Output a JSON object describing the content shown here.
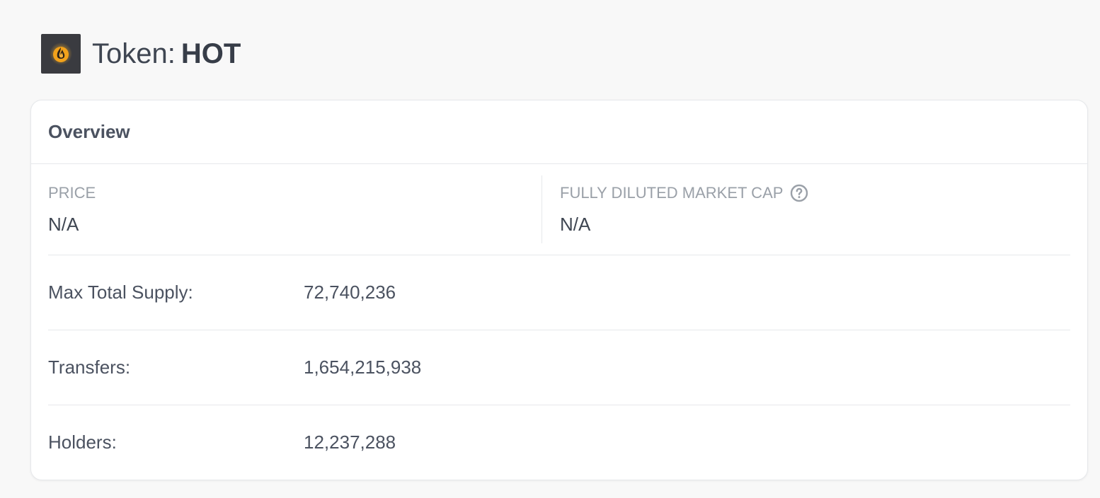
{
  "header": {
    "prefix": "Token:",
    "symbol": "HOT",
    "logo_icon": "flame-icon"
  },
  "overview": {
    "title": "Overview",
    "price": {
      "label": "PRICE",
      "value": "N/A"
    },
    "market_cap": {
      "label": "FULLY DILUTED MARKET CAP",
      "value": "N/A",
      "help_icon": "question-circle-icon"
    },
    "rows": [
      {
        "label": "Max Total Supply:",
        "value": "72,740,236"
      },
      {
        "label": "Transfers:",
        "value": "1,654,215,938"
      },
      {
        "label": "Holders:",
        "value": "12,237,288"
      }
    ]
  },
  "colors": {
    "background": "#f8f8f8",
    "card": "#ffffff",
    "border": "#e6e8eb",
    "muted_text": "#9aa0a8",
    "text": "#3f4652",
    "logo_bg": "#3a3b40",
    "flame": "#f2a21b"
  }
}
